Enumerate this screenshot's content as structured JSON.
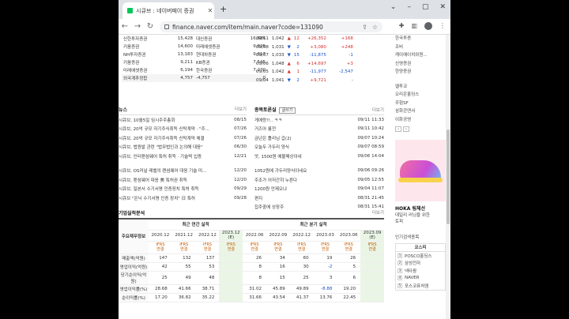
{
  "browser": {
    "tab_title": "시큐브 : 네이버페이 증권",
    "url": "finance.naver.com/item/main.naver?code=131090"
  },
  "broker_rows": [
    {
      "name": "신한투자증권",
      "v1": "15,428",
      "name2": "대신증권",
      "v2": "16,686"
    },
    {
      "name": "키움증권",
      "v1": "14,600",
      "name2": "미래에셋증권",
      "v2": "9,825"
    },
    {
      "name": "NH투자증권",
      "v1": "13,183",
      "name2": "현대차증권",
      "v2": "9,617"
    },
    {
      "name": "키움증권",
      "v1": "9,211",
      "name2": "KB증권",
      "v2": "7,545"
    },
    {
      "name": "미래에셋증권",
      "v1": "6,194",
      "name2": "한국증권",
      "v2": "7,270"
    },
    {
      "name": "외국계추정합",
      "v1": "4,757",
      "name2": "-4,757",
      "v2": "0"
    }
  ],
  "daily_rows": [
    {
      "date": "09/11",
      "price": "1,042",
      "arrow": "▲",
      "chg": "12",
      "vol": "+26,352",
      "net": "+168",
      "dir": "up"
    },
    {
      "date": "09/08",
      "price": "1,031",
      "arrow": "▼",
      "chg": "2",
      "vol": "+3,080",
      "net": "+248",
      "dir": "dn"
    },
    {
      "date": "09/07",
      "price": "1,033",
      "arrow": "▼",
      "chg": "15",
      "vol": "-11,875",
      "net": "-1",
      "dir": "dn"
    },
    {
      "date": "09/06",
      "price": "1,048",
      "arrow": "▲",
      "chg": "6",
      "vol": "+14,697",
      "net": "+3",
      "dir": "up"
    },
    {
      "date": "09/05",
      "price": "1,042",
      "arrow": "▲",
      "chg": "1",
      "vol": "-11,977",
      "net": "-2,547",
      "dir": "up"
    },
    {
      "date": "09/04",
      "price": "1,041",
      "arrow": "▼",
      "chg": "2",
      "vol": "+9,721",
      "net": "-",
      "dir": "dn"
    }
  ],
  "news": {
    "title": "뉴스",
    "more": "더보기",
    "items": [
      {
        "t": "시큐브, 10월5일 임시주주총회",
        "d": "08/15"
      },
      {
        "t": "시큐브, 20억 규모 자기주식취득 신탁계약 · \"주...",
        "d": "07/26"
      },
      {
        "t": "시큐브, 20억 규모 자기주식취득 신탁계약 체결",
        "d": "07/26"
      },
      {
        "t": "시큐브, 법원발 관련 \"법무법인과 논의해 대응\"",
        "d": "06/30"
      },
      {
        "t": "시큐브, 인터랜섬웨어 특허 취득 · 기술력 입증",
        "d": "12/21"
      },
      {
        "t": "시큐브, OS커널 레벨의 랜섬웨어 대응 기술 미...",
        "d": "12/20"
      },
      {
        "t": "시큐브, 랜섬웨어 대응 美 특허권 취득",
        "d": "12/20"
      },
      {
        "t": "시큐브, 일본서 수기서명 인증장치 특허 취득",
        "d": "09/29"
      },
      {
        "t": "시큐브 \"온닉 수기서명 인증 장치\" 日 특허",
        "d": "09/28"
      }
    ]
  },
  "board": {
    "title": "종목토론실",
    "write": "글쓰기",
    "more": "더보기",
    "items": [
      {
        "t": "게에랑!!.. ㅋㅋ",
        "d": "09/11 11:33"
      },
      {
        "t": "거즈아 롱전",
        "d": "09/11 10:42"
      },
      {
        "t": "금년은 틀리님 갑(2)",
        "d": "09/07 10:24"
      },
      {
        "t": "오늘두 가두리 양식",
        "d": "09/07 08:59"
      },
      {
        "t": "앗, 1500원 예불매상이네",
        "d": "09/06 14:04"
      },
      {
        "t": "1052원에 가두리양식이네요",
        "d": "09/06 09:26"
      },
      {
        "t": "주조가 어저간히 누른다",
        "d": "09/05 12:55"
      },
      {
        "t": "1200원 언제오냐",
        "d": "09/04 11:07"
      },
      {
        "t": "편지",
        "d": "08/31 21:45"
      },
      {
        "t": "집주중에 상장주",
        "d": "08/31 15:41"
      }
    ]
  },
  "financials": {
    "title": "기업실적분석",
    "more": "더보기",
    "group_annual": "최근 연간 실적",
    "group_quarter": "최근 분기 실적",
    "row_header": "주요재무정보",
    "periods": [
      "2020.12",
      "2021.12",
      "2022.12",
      "2023.12\n(E)",
      "2022.06",
      "2022.09",
      "2022.12",
      "2023.03",
      "2023.06",
      "2023.09\n(E)"
    ],
    "ifrs_label": "IFRS\n연결",
    "rows": [
      {
        "label": "매출액(억원)",
        "vals": [
          "147",
          "132",
          "137",
          "",
          "26",
          "34",
          "60",
          "19",
          "26",
          ""
        ]
      },
      {
        "label": "영업이익(억원)",
        "vals": [
          "42",
          "55",
          "53",
          "",
          "8",
          "16",
          "30",
          "-2",
          "5",
          ""
        ]
      },
      {
        "label": "당기순이익(억원)",
        "vals": [
          "25",
          "49",
          "48",
          "",
          "8",
          "15",
          "25",
          "3",
          "6",
          ""
        ]
      },
      {
        "label": "영업이익률(%)",
        "vals": [
          "28.68",
          "41.66",
          "38.71",
          "",
          "31.02",
          "45.89",
          "49.89",
          "-8.88",
          "19.20",
          ""
        ]
      },
      {
        "label": "순이익률(%)",
        "vals": [
          "17.20",
          "36.82",
          "35.22",
          "",
          "31.66",
          "43.54",
          "41.37",
          "13.76",
          "22.45",
          ""
        ]
      }
    ]
  },
  "right_col": {
    "brokers": [
      "한국투증",
      "조비",
      "케이에이치와원...",
      "신영증권",
      "한양증권"
    ],
    "related": [
      "엘투코",
      "오리온홀딩스",
      "주험SF",
      "삼화콘덴서",
      "이화공영"
    ],
    "ad_title": "HOKA 림체선",
    "ad_line1": "데일리 러닝을 위한",
    "ad_line2": "토피",
    "pop_title": "인기검색종목",
    "pop_head": "코스피",
    "pop_items": [
      "POSCO홀딩스",
      "삼성전자",
      "넥타팜",
      "NAVER",
      "포스코퓨처엠"
    ]
  }
}
